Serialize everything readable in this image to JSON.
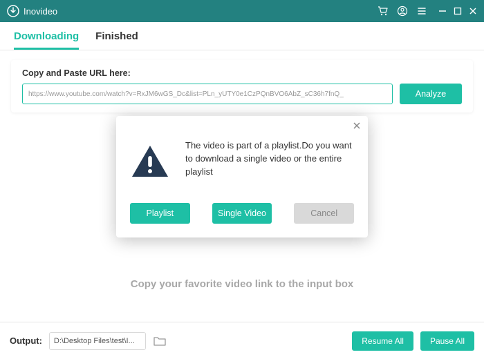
{
  "app": {
    "title": "Inovideo"
  },
  "tabs": {
    "downloading": "Downloading",
    "finished": "Finished"
  },
  "url_panel": {
    "label": "Copy and Paste URL here:",
    "value": "https://www.youtube.com/watch?v=RxJM6wGS_Dc&list=PLn_yUTY0e1CzPQnBVO6AbZ_sC36h7fnQ_",
    "analyze": "Analyze"
  },
  "hint": "Copy your favorite video link to the input box",
  "bottom": {
    "output_label": "Output:",
    "output_path": "D:\\Desktop Files\\test\\I...",
    "resume": "Resume All",
    "pause": "Pause All"
  },
  "modal": {
    "message": "The video is part of a playlist.Do you want to download a single video or the entire playlist",
    "playlist": "Playlist",
    "single": "Single Video",
    "cancel": "Cancel"
  }
}
